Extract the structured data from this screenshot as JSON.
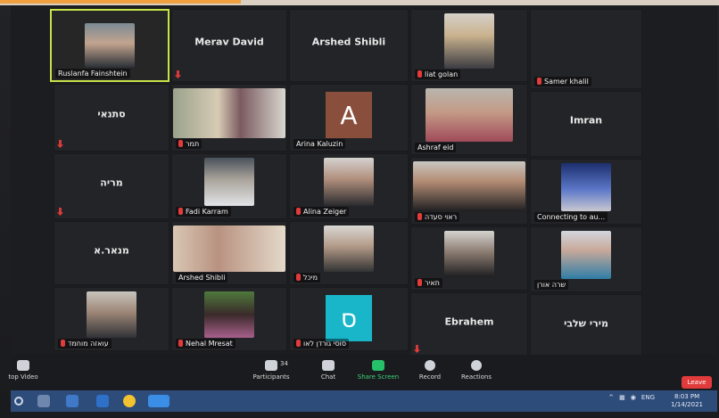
{
  "tiles": {
    "r1": {
      "ruslanfa": {
        "label": "Ruslanfa Fainshtein"
      },
      "merav": {
        "name": "Merav David"
      },
      "arshed": {
        "name": "Arshed Shibli"
      },
      "liat": {
        "label": "liat golan"
      },
      "samer": {
        "label": "Samer khalil"
      }
    },
    "r2": {
      "sanai": {
        "name": "סתנאי"
      },
      "tamar": {
        "label": "תמר"
      },
      "arina": {
        "label": "Arina Kaluzin",
        "avatar": "A"
      },
      "ashraf": {
        "label": "Ashraf eid"
      },
      "imran": {
        "name": "Imran"
      }
    },
    "r3": {
      "maria": {
        "name": "מריה"
      },
      "fadi": {
        "label": "Fadi Karram"
      },
      "alina": {
        "label": "Alina Zeiger"
      },
      "rawi": {
        "label": "ראוי סעדה"
      },
      "connecting": {
        "label": "Connecting to au..."
      }
    },
    "r4": {
      "manar": {
        "name": "מנאר.א"
      },
      "arshed2": {
        "label": "Arshed Shibli"
      },
      "michal": {
        "label": "מיכל"
      },
      "tair": {
        "label": "תאיר"
      },
      "sara": {
        "label": "שרה אורן"
      }
    },
    "r5": {
      "wael": {
        "label": "עואזה מוחמד"
      },
      "nehal": {
        "label": "Nehal Mresat"
      },
      "sosi": {
        "label": "סוסי גורדן לאו",
        "avatar": "ס"
      },
      "ebrahem": {
        "name": "Ebrahem"
      },
      "miri": {
        "name": "מירי שלבי"
      }
    }
  },
  "toolbar": {
    "stop_video": "top Video",
    "participants": "Participants",
    "participants_count": "34",
    "chat": "Chat",
    "share_screen": "Share Screen",
    "record": "Record",
    "reactions": "Reactions",
    "leave": "Leave"
  },
  "taskbar": {
    "lang": "ENG",
    "time": "8:03 PM",
    "date": "1/14/2021"
  },
  "colors": {
    "accent": "#26c06a",
    "leave": "#e23b3b",
    "active_border": "#c7e24a"
  }
}
